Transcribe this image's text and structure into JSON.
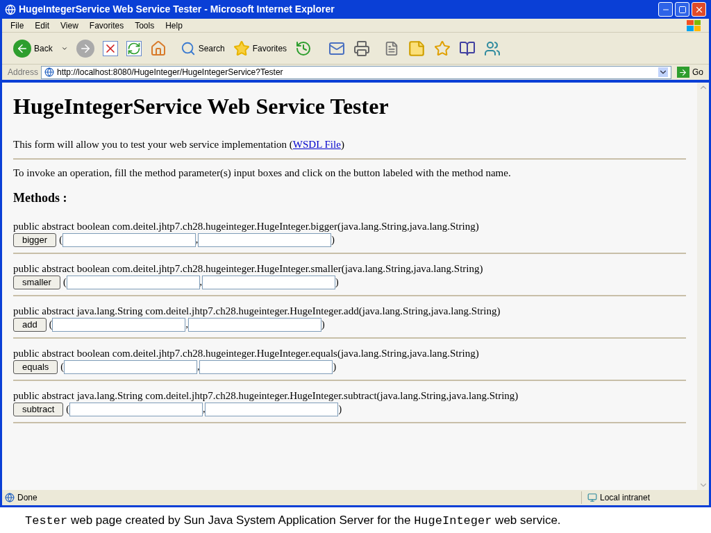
{
  "window": {
    "title": "HugeIntegerService Web Service Tester - Microsoft Internet Explorer"
  },
  "menu": [
    "File",
    "Edit",
    "View",
    "Favorites",
    "Tools",
    "Help"
  ],
  "toolbar": {
    "back": "Back",
    "search": "Search",
    "favorites": "Favorites"
  },
  "address": {
    "label": "Address",
    "value": "http://localhost:8080/HugeInteger/HugeIntegerService?Tester",
    "go": "Go"
  },
  "page": {
    "heading": "HugeIntegerService Web Service Tester",
    "intro": "This form will allow you to test your web service implementation (",
    "intro_link": "WSDL File",
    "intro_end": ")",
    "instructions": "To invoke an operation, fill the method parameter(s) input boxes and click on the button labeled with the method name.",
    "methods_heading": "Methods :",
    "methods": [
      {
        "signature": "public abstract boolean com.deitel.jhtp7.ch28.hugeinteger.HugeInteger.bigger(java.lang.String,java.lang.String)",
        "button": "bigger",
        "open": "(",
        "separator": ",",
        "close": ")"
      },
      {
        "signature": "public abstract boolean com.deitel.jhtp7.ch28.hugeinteger.HugeInteger.smaller(java.lang.String,java.lang.String)",
        "button": "smaller",
        "open": "(",
        "separator": ",",
        "close": ")"
      },
      {
        "signature": "public abstract java.lang.String com.deitel.jhtp7.ch28.hugeinteger.HugeInteger.add(java.lang.String,java.lang.String)",
        "button": "add",
        "open": "(",
        "separator": ",",
        "close": ")"
      },
      {
        "signature": "public abstract boolean com.deitel.jhtp7.ch28.hugeinteger.HugeInteger.equals(java.lang.String,java.lang.String)",
        "button": "equals",
        "open": "(",
        "separator": ",",
        "close": ")"
      },
      {
        "signature": "public abstract java.lang.String com.deitel.jhtp7.ch28.hugeinteger.HugeInteger.subtract(java.lang.String,java.lang.String)",
        "button": "subtract",
        "open": "(",
        "separator": ",",
        "close": ")"
      }
    ]
  },
  "status_bar": {
    "status": "Done",
    "zone": "Local intranet"
  },
  "caption": [
    {
      "kind": "code",
      "text": "Tester"
    },
    {
      "kind": "text",
      "text": " web page created by Sun Java System Application Server for the "
    },
    {
      "kind": "code",
      "text": "HugeInteger"
    },
    {
      "kind": "text",
      "text": " web service."
    }
  ]
}
